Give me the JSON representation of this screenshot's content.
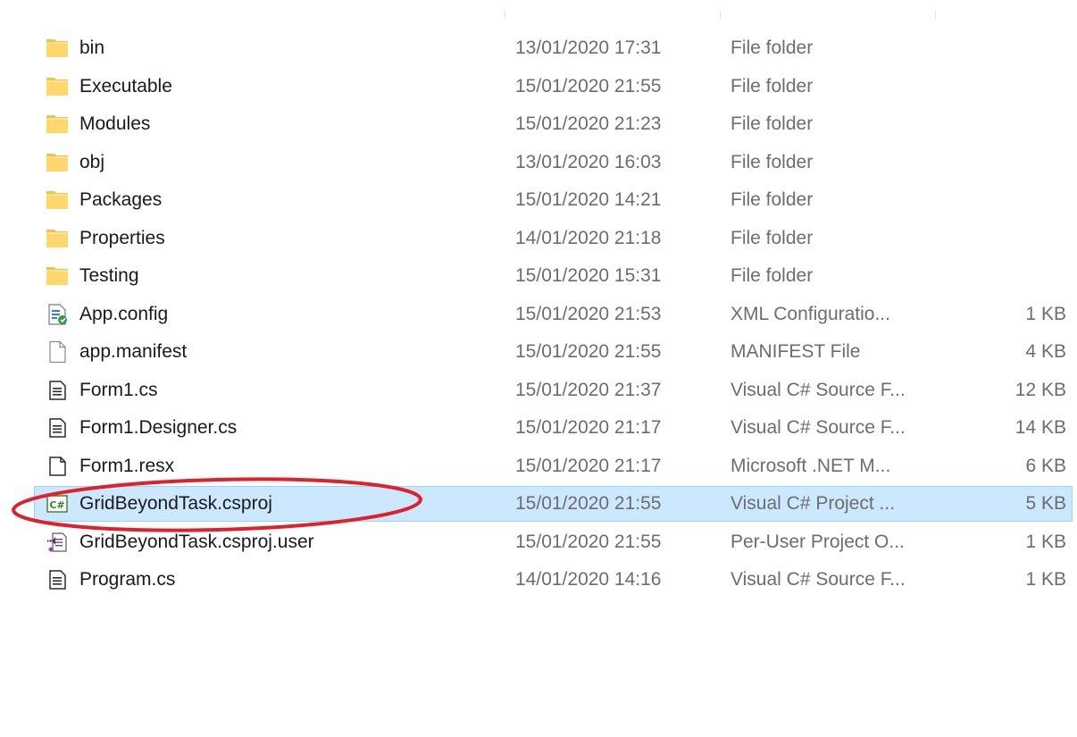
{
  "files": [
    {
      "name": "bin",
      "date": "13/01/2020 17:31",
      "type": "File folder",
      "size": "",
      "icon": "folder-icon"
    },
    {
      "name": "Executable",
      "date": "15/01/2020 21:55",
      "type": "File folder",
      "size": "",
      "icon": "folder-icon"
    },
    {
      "name": "Modules",
      "date": "15/01/2020 21:23",
      "type": "File folder",
      "size": "",
      "icon": "folder-icon"
    },
    {
      "name": "obj",
      "date": "13/01/2020 16:03",
      "type": "File folder",
      "size": "",
      "icon": "folder-icon"
    },
    {
      "name": "Packages",
      "date": "15/01/2020 14:21",
      "type": "File folder",
      "size": "",
      "icon": "folder-icon"
    },
    {
      "name": "Properties",
      "date": "14/01/2020 21:18",
      "type": "File folder",
      "size": "",
      "icon": "folder-icon"
    },
    {
      "name": "Testing",
      "date": "15/01/2020 15:31",
      "type": "File folder",
      "size": "",
      "icon": "folder-icon"
    },
    {
      "name": "App.config",
      "date": "15/01/2020 21:53",
      "type": "XML Configuratio...",
      "size": "1 KB",
      "icon": "config-file-icon"
    },
    {
      "name": "app.manifest",
      "date": "15/01/2020 21:55",
      "type": "MANIFEST File",
      "size": "4 KB",
      "icon": "blank-file-icon"
    },
    {
      "name": "Form1.cs",
      "date": "15/01/2020 21:37",
      "type": "Visual C# Source F...",
      "size": "12 KB",
      "icon": "text-file-icon"
    },
    {
      "name": "Form1.Designer.cs",
      "date": "15/01/2020 21:17",
      "type": "Visual C# Source F...",
      "size": "14 KB",
      "icon": "text-file-icon"
    },
    {
      "name": "Form1.resx",
      "date": "15/01/2020 21:17",
      "type": "Microsoft .NET M...",
      "size": "6 KB",
      "icon": "resx-file-icon"
    },
    {
      "name": "GridBeyondTask.csproj",
      "date": "15/01/2020 21:55",
      "type": "Visual C# Project ...",
      "size": "5 KB",
      "icon": "csharp-project-icon"
    },
    {
      "name": "GridBeyondTask.csproj.user",
      "date": "15/01/2020 21:55",
      "type": "Per-User Project O...",
      "size": "1 KB",
      "icon": "visual-studio-user-file-icon"
    },
    {
      "name": "Program.cs",
      "date": "14/01/2020 14:16",
      "type": "Visual C# Source F...",
      "size": "1 KB",
      "icon": "text-file-icon"
    }
  ],
  "selected_file": "GridBeyondTask.csproj",
  "colors": {
    "selection_bg": "#cce8ff",
    "selection_border": "#99d1ff",
    "annotation": "#e0202a",
    "folder": "#ffd35a",
    "csharp": "#3a7d2c"
  }
}
